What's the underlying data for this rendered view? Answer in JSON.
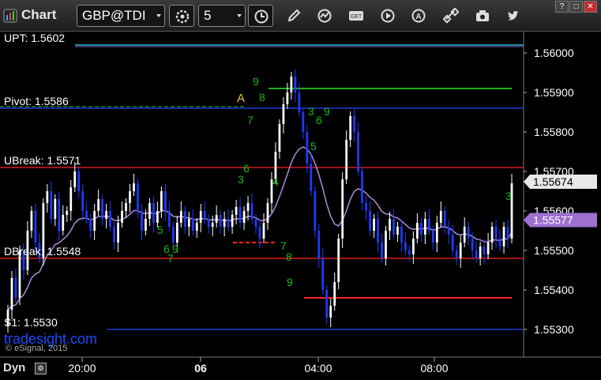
{
  "app": {
    "title": "Chart"
  },
  "toolbar": {
    "symbol": "GBP@TDI",
    "interval": "5"
  },
  "window_buttons": [
    "?",
    "□",
    "✕"
  ],
  "price_labels": [
    {
      "key": "upt",
      "text": "UPT: 1.5602",
      "value": 1.5602,
      "color": "#3ee0ff"
    },
    {
      "key": "pivot",
      "text": "Pivot: 1.5586",
      "value": 1.5586,
      "color": "#2646ff"
    },
    {
      "key": "ubreak",
      "text": "UBreak: 1.5571",
      "value": 1.5571,
      "color": "#ff2020"
    },
    {
      "key": "dbreak",
      "text": "DBreak: 1.5548",
      "value": 1.5548,
      "color": "#ff2020"
    },
    {
      "key": "s1",
      "text": "S1: 1.5530",
      "value": 1.553,
      "color": "#2646ff"
    }
  ],
  "watermark": "tradesight.com",
  "copyright": "© eSignal, 2015",
  "footer": {
    "dyn_label": "Dyn"
  },
  "marker_a": "A",
  "chart_data": {
    "type": "candlestick",
    "title": "GBP@TDI",
    "interval_minutes": 5,
    "y_ticks": [
      1.56,
      1.559,
      1.558,
      1.557,
      1.556,
      1.555,
      1.554,
      1.553
    ],
    "y_tick_labels": [
      "1.56000",
      "1.55900",
      "1.55800",
      "1.55700",
      "1.55600",
      "1.55500",
      "1.55400",
      "1.55300"
    ],
    "ylim": [
      1.5514,
      1.5617
    ],
    "x_tick_labels": [
      "20:00",
      "06",
      "04:00",
      "08:00"
    ],
    "last_price": {
      "text": "1.55674",
      "value": 1.55674
    },
    "ma_value": {
      "text": "1.55577",
      "value": 1.55577,
      "color": "#a070d0"
    },
    "levels": [
      {
        "name": "UPT",
        "value": 1.5602,
        "color": "#3ee0ff"
      },
      {
        "name": "Pivot",
        "value": 1.5586,
        "color": "#2646ff"
      },
      {
        "name": "UBreak",
        "value": 1.5571,
        "color": "#ff2020"
      },
      {
        "name": "DBreak",
        "value": 1.5548,
        "color": "#ff2020"
      },
      {
        "name": "S1",
        "value": 1.553,
        "color": "#2646ff"
      }
    ],
    "segments": [
      {
        "value": 1.5591,
        "color": "#20b020"
      },
      {
        "value": 1.5538,
        "color": "#ff2020"
      },
      {
        "value": 1.5552,
        "color": "#ff2020",
        "dashed": true
      }
    ],
    "closes": [
      1.5535,
      1.5543,
      1.5538,
      1.555,
      1.5545,
      1.5555,
      1.556,
      1.5552,
      1.5548,
      1.5562,
      1.5565,
      1.5558,
      1.5563,
      1.5555,
      1.5559,
      1.556,
      1.5566,
      1.557,
      1.5565,
      1.556,
      1.5558,
      1.5555,
      1.556,
      1.5563,
      1.5558,
      1.556,
      1.5556,
      1.5552,
      1.5557,
      1.556,
      1.5562,
      1.5565,
      1.5567,
      1.556,
      1.5555,
      1.5558,
      1.5562,
      1.5557,
      1.556,
      1.5565,
      1.556,
      1.5556,
      1.5552,
      1.5557,
      1.556,
      1.5556,
      1.5558,
      1.5555,
      1.5557,
      1.556,
      1.5558,
      1.5556,
      1.5557,
      1.5559,
      1.5556,
      1.5558,
      1.5556,
      1.5559,
      1.5561,
      1.5557,
      1.556,
      1.5562,
      1.5558,
      1.5556,
      1.5553,
      1.5557,
      1.5562,
      1.5568,
      1.5575,
      1.5582,
      1.5587,
      1.559,
      1.5594,
      1.559,
      1.5585,
      1.558,
      1.5572,
      1.5565,
      1.5555,
      1.5548,
      1.554,
      1.5533,
      1.5536,
      1.5542,
      1.5553,
      1.5568,
      1.5578,
      1.5584,
      1.558,
      1.557,
      1.5562,
      1.556,
      1.5555,
      1.5558,
      1.5552,
      1.5548,
      1.5555,
      1.5558,
      1.5554,
      1.5556,
      1.5552,
      1.555,
      1.5549,
      1.5553,
      1.5557,
      1.5554,
      1.5558,
      1.5555,
      1.5552,
      1.5557,
      1.556,
      1.5556,
      1.5554,
      1.555,
      1.5548,
      1.5552,
      1.5556,
      1.5553,
      1.555,
      1.5548,
      1.5551,
      1.5549,
      1.5552,
      1.5556,
      1.5553,
      1.5551,
      1.5556,
      1.5553,
      1.5567
    ]
  }
}
